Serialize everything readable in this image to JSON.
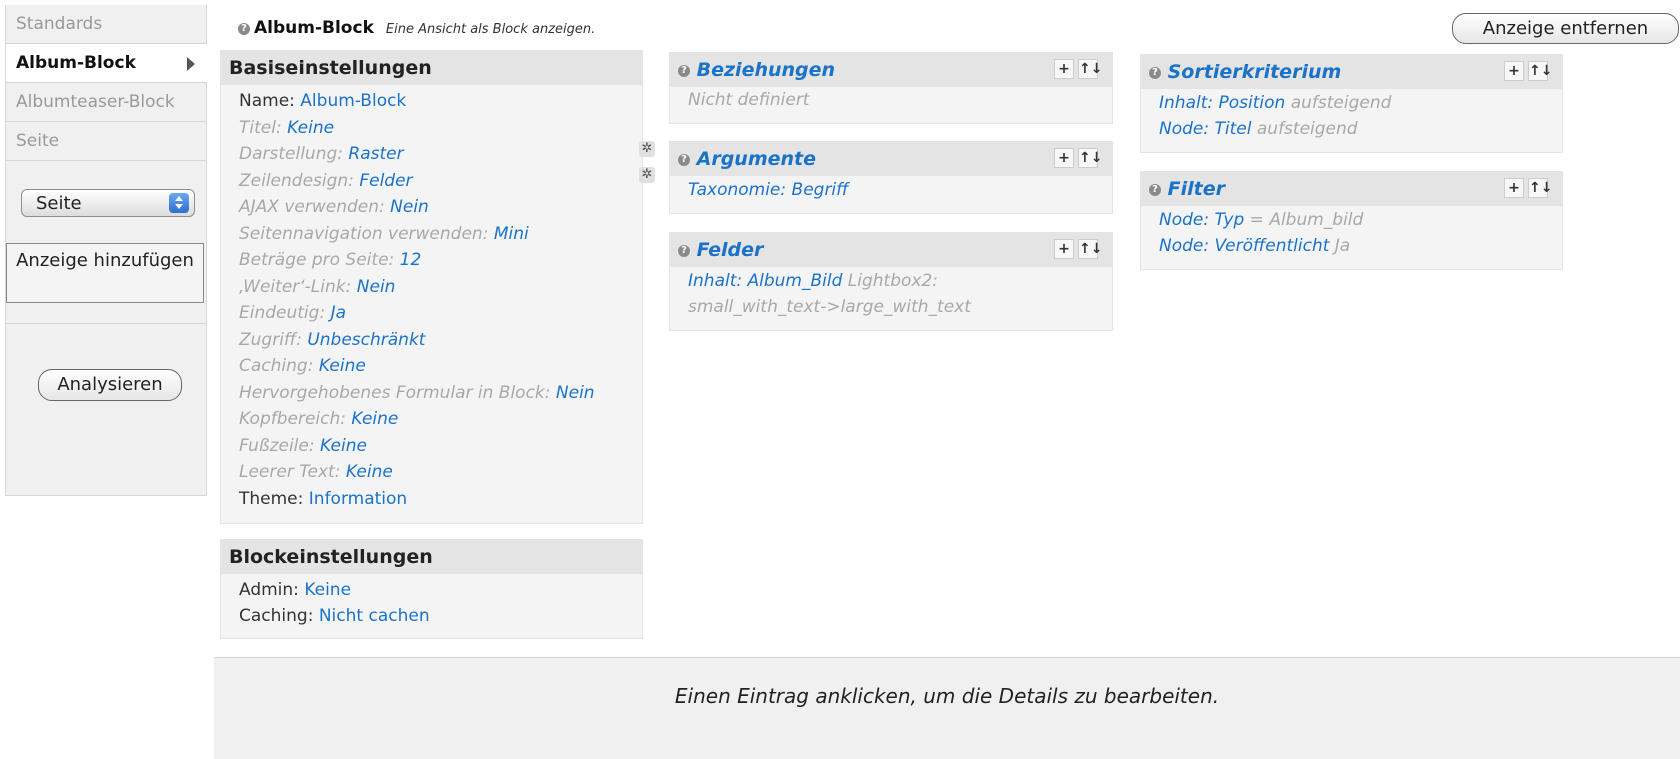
{
  "sidebar": {
    "tabs": [
      {
        "label": "Standards",
        "active": false
      },
      {
        "label": "Album-Block",
        "active": true
      },
      {
        "label": "Albumteaser-Block",
        "active": false
      },
      {
        "label": "Seite",
        "active": false
      }
    ],
    "select_value": "Seite",
    "add_display_label": "Anzeige hinzufügen",
    "analyze_label": "Analysieren"
  },
  "header": {
    "title": "Album-Block",
    "description": "Eine Ansicht als Block anzeigen.",
    "remove_label": "Anzeige entfernen",
    "help_icon": "?"
  },
  "basic": {
    "title": "Basiseinstellungen",
    "rows": [
      {
        "label": "Name:",
        "value": "Album-Block"
      },
      {
        "label": "Titel:",
        "value": "Keine"
      },
      {
        "label": "Darstellung:",
        "value": "Raster"
      },
      {
        "label": "Zeilendesign:",
        "value": "Felder"
      },
      {
        "label": "AJAX verwenden:",
        "value": "Nein"
      },
      {
        "label": "Seitennavigation verwenden:",
        "value": "Mini"
      },
      {
        "label": "Beträge pro Seite:",
        "value": "12"
      },
      {
        "label": "‚Weiter‘-Link:",
        "value": "Nein"
      },
      {
        "label": "Eindeutig:",
        "value": "Ja"
      },
      {
        "label": "Zugriff:",
        "value": "Unbeschränkt"
      },
      {
        "label": "Caching:",
        "value": "Keine"
      },
      {
        "label": "Hervorgehobenes Formular in Block:",
        "value": "Nein"
      },
      {
        "label": "Kopfbereich:",
        "value": "Keine"
      },
      {
        "label": "Fußzeile:",
        "value": "Keine"
      },
      {
        "label": "Leerer Text:",
        "value": "Keine"
      },
      {
        "label": "Theme:",
        "value": "Information"
      }
    ]
  },
  "block": {
    "title": "Blockeinstellungen",
    "rows": [
      {
        "label": "Admin:",
        "value": "Keine"
      },
      {
        "label": "Caching:",
        "value": "Nicht cachen"
      }
    ]
  },
  "relations": {
    "title": "Beziehungen",
    "empty": "Nicht definiert"
  },
  "arguments": {
    "title": "Argumente",
    "item": "Taxonomie: Begriff"
  },
  "fields": {
    "title": "Felder",
    "item_link": "Inhalt: Album_Bild",
    "item_rest1": "Lightbox2:",
    "item_rest2": "small_with_text->large_with_text"
  },
  "sort": {
    "title": "Sortierkriterium",
    "items": [
      {
        "link": "Inhalt: Position",
        "rest": "aufsteigend"
      },
      {
        "link": "Node: Titel",
        "rest": "aufsteigend"
      }
    ]
  },
  "filter": {
    "title": "Filter",
    "items": [
      {
        "link": "Node: Typ",
        "rest": "= Album_bild"
      },
      {
        "link": "Node: Veröffentlicht",
        "rest": "Ja"
      }
    ]
  },
  "tools": {
    "add": "+",
    "rearrange": "↑↓"
  },
  "footer": {
    "message": "Einen Eintrag anklicken, um die Details zu bearbeiten."
  }
}
